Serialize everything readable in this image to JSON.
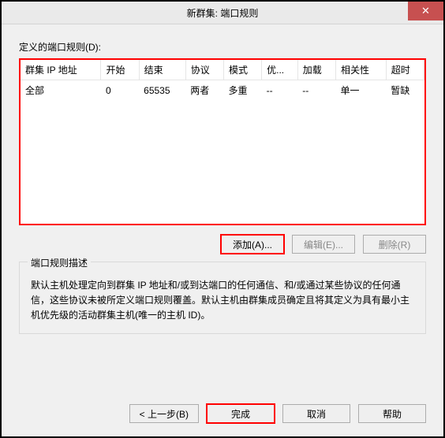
{
  "title": "新群集: 端口规则",
  "rulesLabel": "定义的端口规则(D):",
  "columns": [
    "群集 IP 地址",
    "开始",
    "结束",
    "协议",
    "模式",
    "优...",
    "加载",
    "相关性",
    "超时"
  ],
  "rows": [
    {
      "clusterIp": "全部",
      "start": "0",
      "end": "65535",
      "protocol": "两者",
      "mode": "多重",
      "priority": "--",
      "load": "--",
      "affinity": "单一",
      "timeout": "暂缺"
    }
  ],
  "buttons": {
    "add": "添加(A)...",
    "edit": "编辑(E)...",
    "delete": "删除(R)",
    "back": "< 上一步(B)",
    "finish": "完成",
    "cancel": "取消",
    "help": "帮助"
  },
  "descTitle": "端口规则描述",
  "descText": "默认主机处理定向到群集 IP 地址和/或到达端口的任何通信、和/或通过某些协议的任何通信，这些协议未被所定义端口规则覆盖。默认主机由群集成员确定且将其定义为具有最小主机优先级的活动群集主机(唯一的主机 ID)。"
}
